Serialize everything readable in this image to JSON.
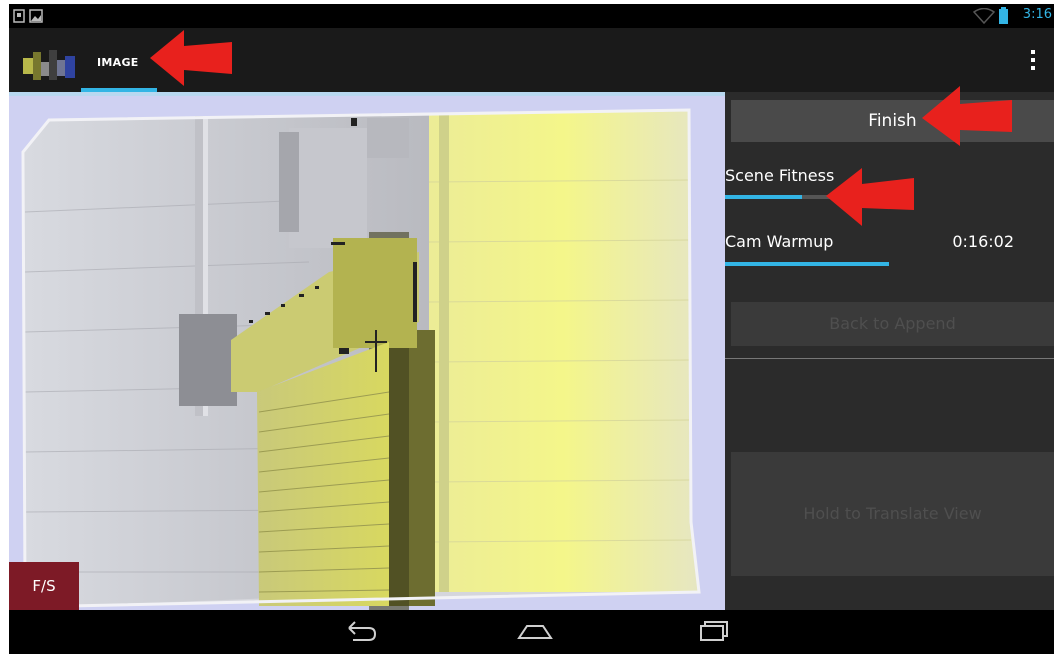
{
  "status_bar": {
    "time": "3:16",
    "icons": [
      "sim-icon",
      "image-notification-icon",
      "wifi-icon",
      "battery-icon"
    ]
  },
  "action_bar": {
    "tab_label": "IMAGE",
    "menu_icon": "overflow-menu-icon"
  },
  "camera_view": {
    "fs_label": "F/S"
  },
  "panel": {
    "finish_label": "Finish",
    "scene_fitness_label": "Scene Fitness",
    "scene_fitness_progress": 0.55,
    "cam_warmup_label": "Cam Warmup",
    "cam_warmup_time": "0:16:02",
    "back_label": "Back to Append",
    "hold_label": "Hold to Translate View"
  },
  "nav_bar": {
    "icons": [
      "back-icon",
      "home-icon",
      "recent-apps-icon"
    ]
  },
  "colors": {
    "accent": "#33b5e5",
    "annotation": "#e8211d",
    "fs_button": "#7d1a26"
  }
}
